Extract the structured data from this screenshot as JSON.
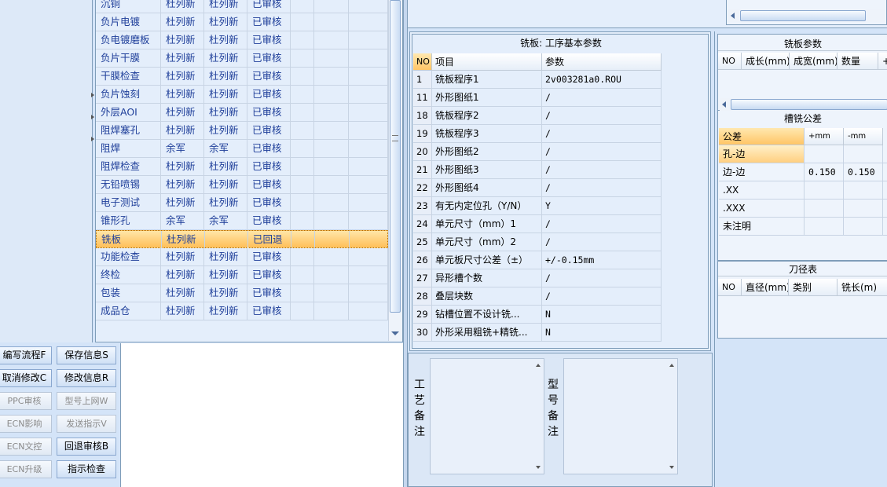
{
  "flow_table": {
    "rows": [
      {
        "name": "沉铜",
        "c1": "杜列新",
        "c2": "杜列新",
        "status": "已审核"
      },
      {
        "name": "负片电镀",
        "c1": "杜列新",
        "c2": "杜列新",
        "status": "已审核"
      },
      {
        "name": "负电镀磨板",
        "c1": "杜列新",
        "c2": "杜列新",
        "status": "已审核"
      },
      {
        "name": "负片干膜",
        "c1": "杜列新",
        "c2": "杜列新",
        "status": "已审核"
      },
      {
        "name": "干膜检查",
        "c1": "杜列新",
        "c2": "杜列新",
        "status": "已审核"
      },
      {
        "name": "负片蚀刻",
        "c1": "杜列新",
        "c2": "杜列新",
        "status": "已审核"
      },
      {
        "name": "外层AOI",
        "c1": "杜列新",
        "c2": "杜列新",
        "status": "已审核"
      },
      {
        "name": "阻焊塞孔",
        "c1": "杜列新",
        "c2": "杜列新",
        "status": "已审核"
      },
      {
        "name": "阻焊",
        "c1": "余军",
        "c2": "余军",
        "status": "已审核"
      },
      {
        "name": "阻焊检查",
        "c1": "杜列新",
        "c2": "杜列新",
        "status": "已审核"
      },
      {
        "name": "无铅喷锡",
        "c1": "杜列新",
        "c2": "杜列新",
        "status": "已审核"
      },
      {
        "name": "电子测试",
        "c1": "杜列新",
        "c2": "杜列新",
        "status": "已审核"
      },
      {
        "name": "锥形孔",
        "c1": "余军",
        "c2": "余军",
        "status": "已审核"
      },
      {
        "name": "铣板",
        "c1": "杜列新",
        "c2": "",
        "status": "已回退"
      },
      {
        "name": "功能检查",
        "c1": "杜列新",
        "c2": "杜列新",
        "status": "已审核"
      },
      {
        "name": "终检",
        "c1": "杜列新",
        "c2": "杜列新",
        "status": "已审核"
      },
      {
        "name": "包装",
        "c1": "杜列新",
        "c2": "杜列新",
        "status": "已审核"
      },
      {
        "name": "成品仓",
        "c1": "杜列新",
        "c2": "杜列新",
        "status": "已审核"
      }
    ],
    "selected_index": 13
  },
  "buttons": {
    "col1": [
      "编写流程F",
      "取消修改C",
      "PPC审核",
      "ECN影响",
      "ECN文控",
      "ECN升级"
    ],
    "col2": [
      "保存信息S",
      "修改信息R",
      "型号上网W",
      "发送指示V",
      "回退审核B",
      "指示检查"
    ],
    "col1_disabled": [
      false,
      false,
      true,
      true,
      true,
      true
    ],
    "col2_disabled": [
      false,
      false,
      true,
      true,
      false,
      false
    ]
  },
  "params": {
    "title": "铣板: 工序基本参数",
    "headers": {
      "no": "NO",
      "item": "项目",
      "value": "参数"
    },
    "rows": [
      {
        "no": "1",
        "item": "铣板程序1",
        "value": "2v003281a0.ROU"
      },
      {
        "no": "11",
        "item": "外形图纸1",
        "value": "/"
      },
      {
        "no": "18",
        "item": "铣板程序2",
        "value": "/"
      },
      {
        "no": "19",
        "item": "铣板程序3",
        "value": "/"
      },
      {
        "no": "20",
        "item": "外形图纸2",
        "value": "/"
      },
      {
        "no": "21",
        "item": "外形图纸3",
        "value": "/"
      },
      {
        "no": "22",
        "item": "外形图纸4",
        "value": "/"
      },
      {
        "no": "23",
        "item": "有无内定位孔（Y/N）",
        "value": "Y"
      },
      {
        "no": "24",
        "item": "单元尺寸（mm）1",
        "value": "/"
      },
      {
        "no": "25",
        "item": "单元尺寸（mm）2",
        "value": "/"
      },
      {
        "no": "26",
        "item": "单元板尺寸公差（±）",
        "value": "+/-0.15mm"
      },
      {
        "no": "27",
        "item": "异形槽个数",
        "value": "/"
      },
      {
        "no": "28",
        "item": "叠层块数",
        "value": "/"
      },
      {
        "no": "29",
        "item": "钻槽位置不设计铣...",
        "value": "N"
      },
      {
        "no": "30",
        "item": "外形采用粗铣+精铣...",
        "value": "N"
      }
    ]
  },
  "notes": {
    "process_label": [
      "工",
      "艺",
      "备",
      "注"
    ],
    "model_label": [
      "型",
      "号",
      "备",
      "注"
    ]
  },
  "mill_params": {
    "title": "铣板参数",
    "headers": [
      "NO",
      "成长(mm)",
      "成宽(mm)",
      "数量",
      "+"
    ]
  },
  "tolerance": {
    "title": "槽铣公差",
    "headers": [
      "公差",
      "+mm",
      "-mm"
    ],
    "rows": [
      {
        "name": "孔-边",
        "plus": "",
        "minus": ""
      },
      {
        "name": "边-边",
        "plus": "0.150",
        "minus": "0.150"
      },
      {
        "name": ".XX",
        "plus": "",
        "minus": ""
      },
      {
        "name": ".XXX",
        "plus": "",
        "minus": ""
      },
      {
        "name": "未注明",
        "plus": "",
        "minus": ""
      }
    ]
  },
  "tools": {
    "title": "刀径表",
    "headers": [
      "NO",
      "直径(mm)",
      "类别",
      "铣长(m)"
    ]
  },
  "colors": {
    "accent": "#1f3f9a",
    "selected": "#ffc566",
    "panel": "#d4e4f8",
    "grid_bg": "#e4eefb"
  }
}
